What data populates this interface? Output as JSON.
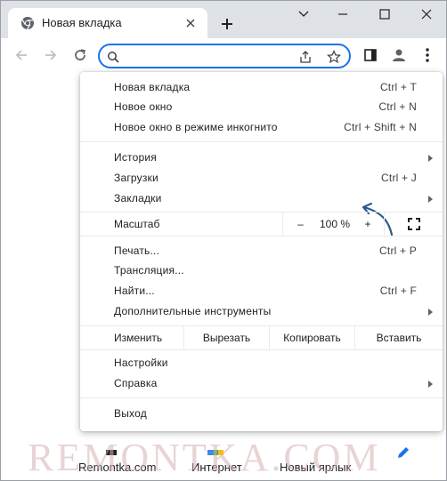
{
  "tab": {
    "title": "Новая вкладка"
  },
  "omnibox": {
    "value": "",
    "placeholder": ""
  },
  "menu": {
    "new_tab": {
      "label": "Новая вкладка",
      "shortcut": "Ctrl + T"
    },
    "new_window": {
      "label": "Новое окно",
      "shortcut": "Ctrl + N"
    },
    "incognito": {
      "label": "Новое окно в режиме инкогнито",
      "shortcut": "Ctrl + Shift + N"
    },
    "history": {
      "label": "История"
    },
    "downloads": {
      "label": "Загрузки",
      "shortcut": "Ctrl + J"
    },
    "bookmarks": {
      "label": "Закладки"
    },
    "zoom": {
      "label": "Масштаб",
      "minus": "–",
      "value": "100 %",
      "plus": "+"
    },
    "print": {
      "label": "Печать...",
      "shortcut": "Ctrl + P"
    },
    "cast": {
      "label": "Трансляция..."
    },
    "find": {
      "label": "Найти...",
      "shortcut": "Ctrl + F"
    },
    "more_tools": {
      "label": "Дополнительные инструменты"
    },
    "edit": {
      "label": "Изменить",
      "cut": "Вырезать",
      "copy": "Копировать",
      "paste": "Вставить"
    },
    "settings": {
      "label": "Настройки"
    },
    "help": {
      "label": "Справка"
    },
    "exit": {
      "label": "Выход"
    }
  },
  "shortcuts": [
    {
      "label": "Remontka.com"
    },
    {
      "label": "Интернет"
    },
    {
      "label": "Новый ярлык"
    }
  ],
  "watermark": "REMONTKA.COM",
  "colors": {
    "accent": "#1a73e8",
    "tabstrip": "#dee1e6",
    "annotation": "#2b5a8c"
  },
  "icons": [
    "chrome-icon",
    "close-icon",
    "plus-icon",
    "minimize-icon",
    "maximize-icon",
    "window-close-icon",
    "back-icon",
    "forward-icon",
    "reload-icon",
    "search-icon",
    "share-icon",
    "star-icon",
    "side-panel-icon",
    "profile-icon",
    "more-icon",
    "fullscreen-icon",
    "pencil-icon"
  ]
}
